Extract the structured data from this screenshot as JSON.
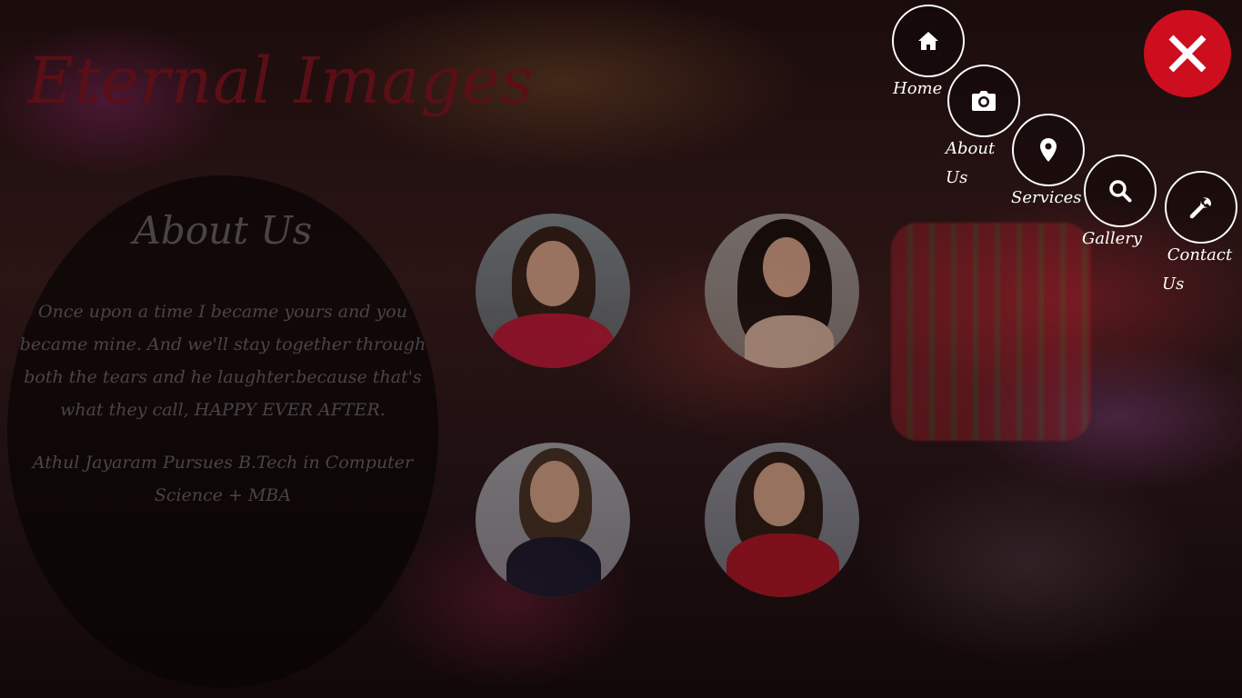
{
  "brand": {
    "name": "Eternal Images",
    "accent": "#cc0e1e"
  },
  "about": {
    "title": "About Us",
    "paragraph1": "Once upon a time I became yours and you became mine. And we'll stay together through both the tears and he laughter.because that's what they call, HAPPY EVER AFTER.",
    "paragraph2": "Athul Jayaram Pursues B.Tech in Computer Science + MBA"
  },
  "nav": {
    "items": [
      {
        "label": "Home",
        "icon": "home-icon"
      },
      {
        "label": "About\nUs",
        "icon": "camera-icon"
      },
      {
        "label": "Services",
        "icon": "map-marker-icon"
      },
      {
        "label": "Gallery",
        "icon": "search-icon"
      },
      {
        "label": "Contact\nUs",
        "icon": "wrench-icon"
      }
    ],
    "close_icon": "close-icon"
  },
  "gallery": {
    "photos": [
      {
        "name": "photo-woman-pink-dress"
      },
      {
        "name": "photo-woman-dark-hair"
      },
      {
        "name": "photo-woman-black-dress"
      },
      {
        "name": "photo-woman-red-saree"
      }
    ]
  }
}
